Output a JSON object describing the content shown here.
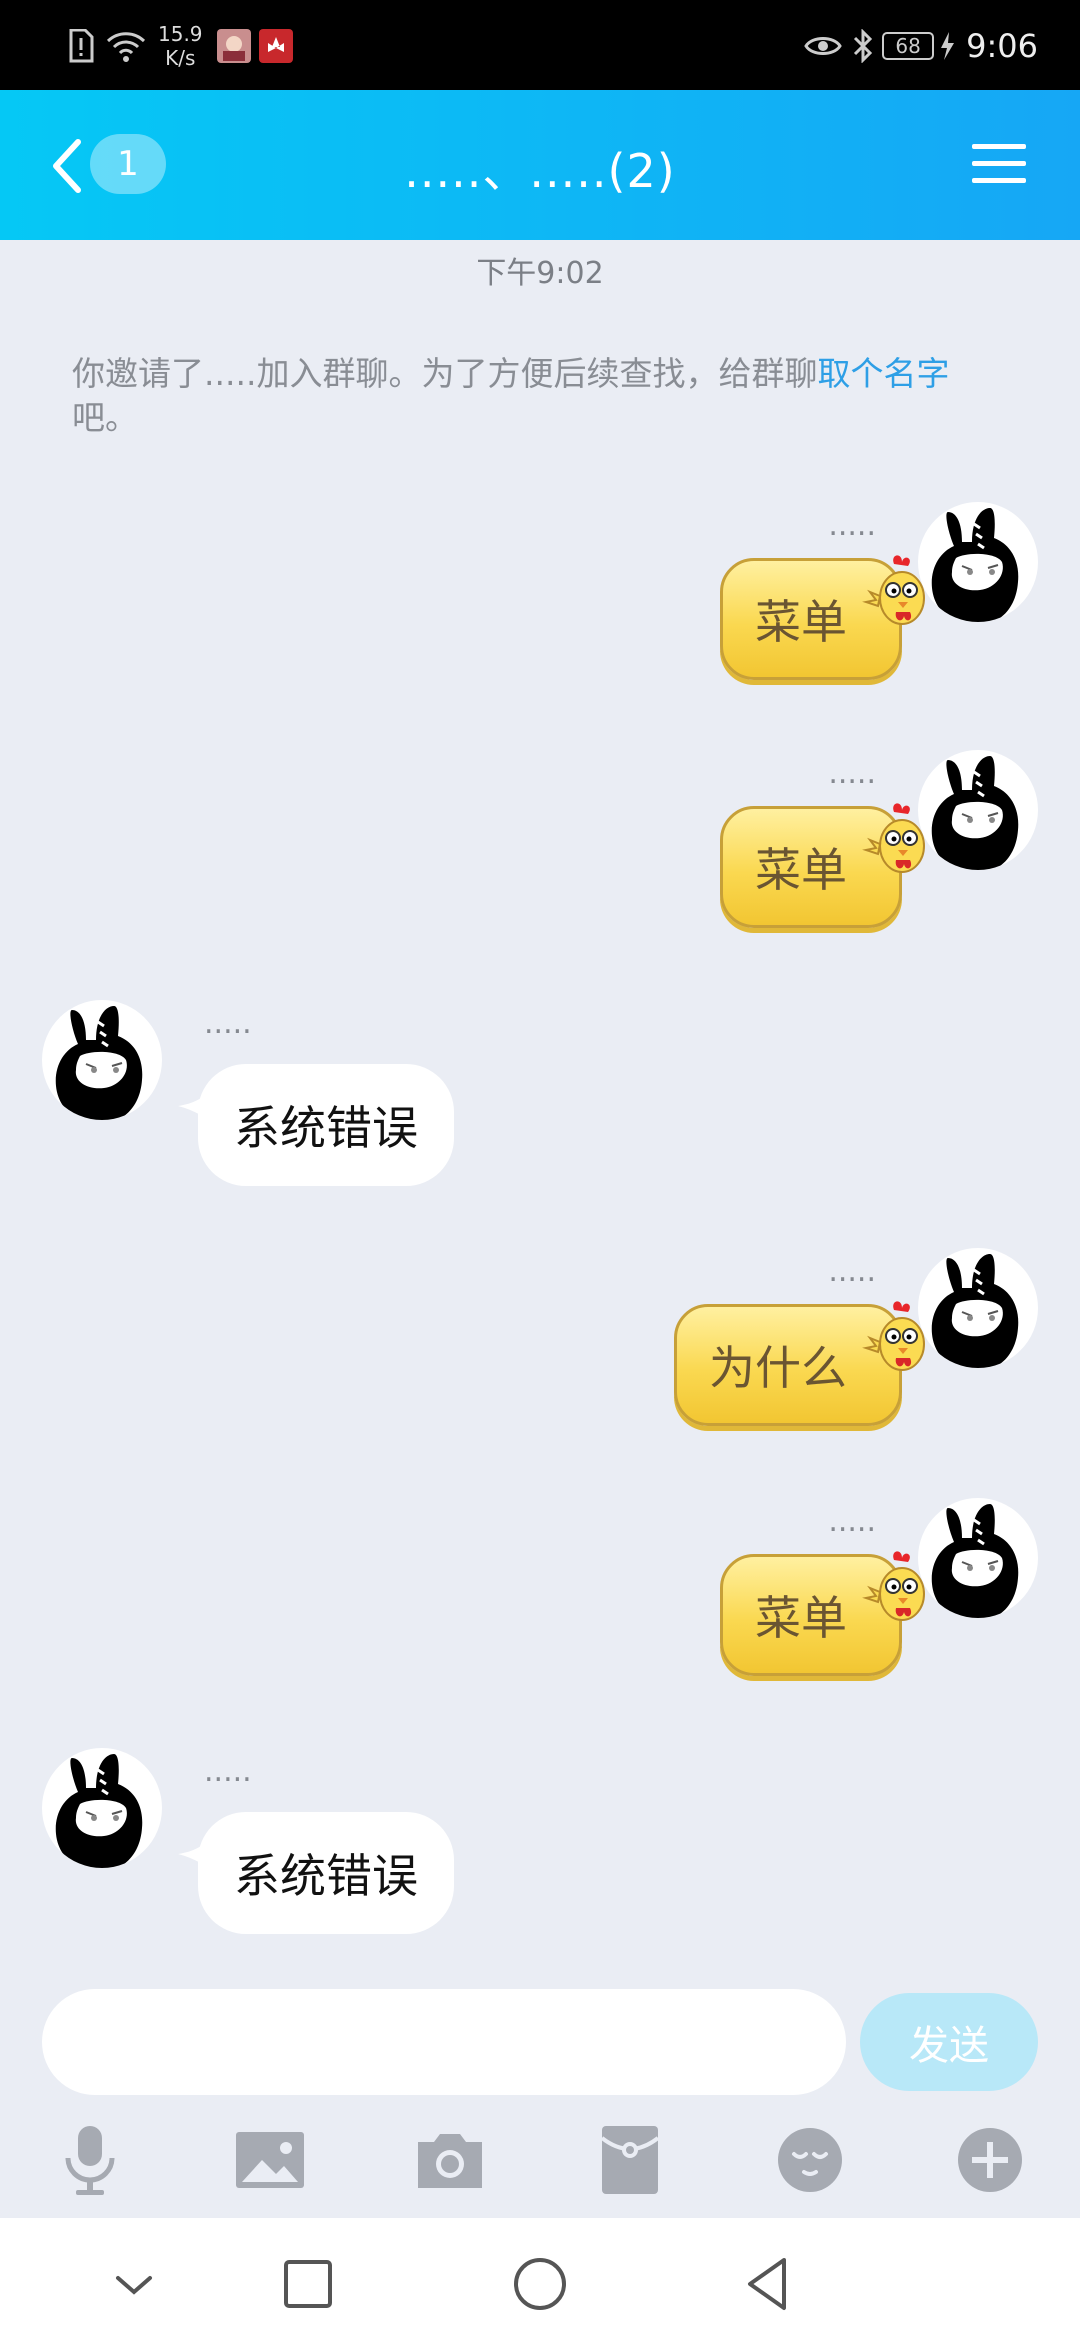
{
  "status_bar": {
    "net_speed_value": "15.9",
    "net_speed_unit": "K/s",
    "battery": "68",
    "time": "9:06"
  },
  "nav": {
    "unread_count": "1",
    "title": ".....、.....(2)"
  },
  "chat": {
    "timestamp": "下午9:02",
    "system_note": {
      "text": "你邀请了.....加入群聊。为了方便后续查找，给群聊",
      "link": "取个名字",
      "suffix": "吧。"
    },
    "messages": [
      {
        "side": "right",
        "sender": ".....",
        "text": "菜单"
      },
      {
        "side": "right",
        "sender": ".....",
        "text": "菜单"
      },
      {
        "side": "left",
        "sender": ".....",
        "text": "系统错误"
      },
      {
        "side": "right",
        "sender": ".....",
        "text": "为什么"
      },
      {
        "side": "right",
        "sender": ".....",
        "text": "菜单"
      },
      {
        "side": "left",
        "sender": ".....",
        "text": "系统错误"
      }
    ]
  },
  "input": {
    "placeholder": "",
    "send_label": "发送"
  },
  "toolbar": {
    "icons": [
      "microphone-icon",
      "image-icon",
      "camera-icon",
      "red-packet-icon",
      "emoji-icon",
      "plus-icon"
    ]
  },
  "colors": {
    "nav_gradient_start": "#05c8f5",
    "nav_gradient_end": "#16a7f5",
    "chat_background": "#eaedf4",
    "link": "#2e9fe6",
    "send_disabled": "#b8e8f8",
    "bubble_yellow": "#fad850"
  }
}
